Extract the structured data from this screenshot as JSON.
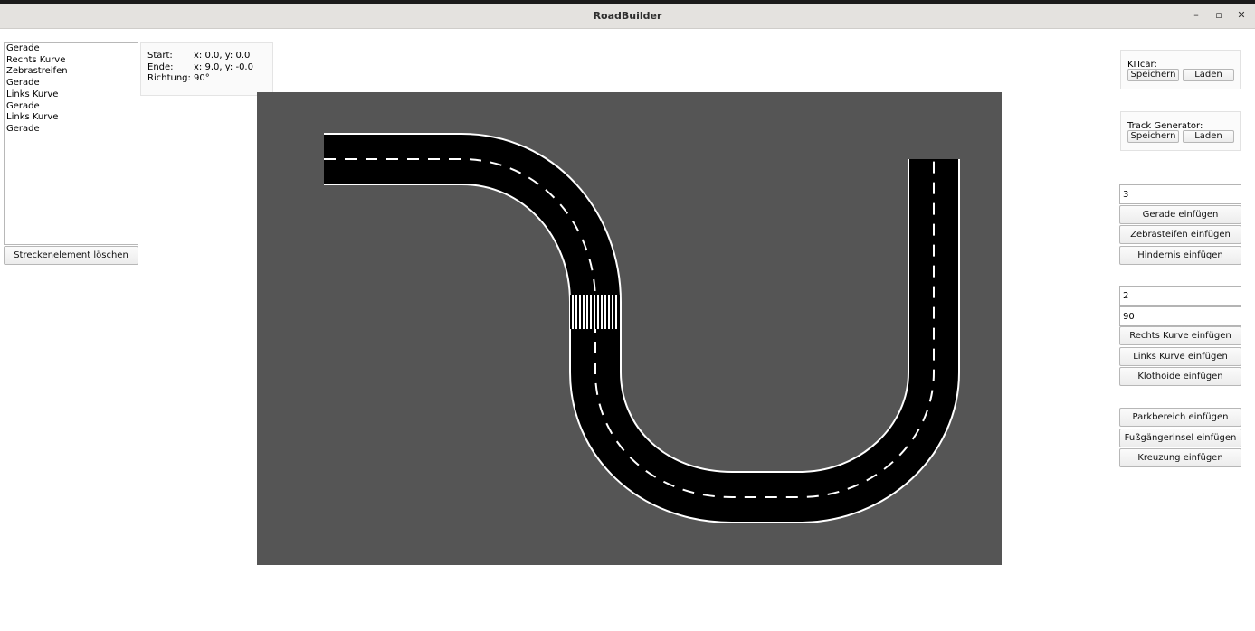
{
  "window": {
    "title": "RoadBuilder",
    "controls": {
      "minimize": "–",
      "maximize": "▫",
      "close": "✕"
    }
  },
  "tracklist": {
    "items": [
      "Gerade",
      "Rechts Kurve",
      "Zebrastreifen",
      "Gerade",
      "Links Kurve",
      "Gerade",
      "Links Kurve",
      "Gerade"
    ],
    "delete_label": "Streckenelement löschen"
  },
  "info": {
    "start_label": "Start:",
    "start_value": "x: 0.0, y: 0.0",
    "end_label": "Ende:",
    "end_value": "x: 9.0, y: -0.0",
    "direction_label": "Richtung:",
    "direction_value": "90°"
  },
  "kitcar": {
    "label": "KITcar:",
    "save": "Speichern",
    "load": "Laden"
  },
  "generator": {
    "label": "Track Generator:",
    "save": "Speichern",
    "load": "Laden"
  },
  "straight": {
    "value": "3",
    "insert_straight": "Gerade einfügen",
    "insert_zebra": "Zebrasteifen einfügen",
    "insert_obstacle": "Hindernis einfügen"
  },
  "curve": {
    "radius_value": "2",
    "angle_value": "90",
    "insert_right": "Rechts Kurve einfügen",
    "insert_left": "Links Kurve einfügen",
    "insert_clothoid": "Klothoide einfügen"
  },
  "special": {
    "parking": "Parkbereich einfügen",
    "pedestrian_island": "Fußgängerinsel einfügen",
    "intersection": "Kreuzung einfügen"
  },
  "colors": {
    "canvas": "#555555",
    "road": "#000000",
    "marking": "#ffffff"
  }
}
